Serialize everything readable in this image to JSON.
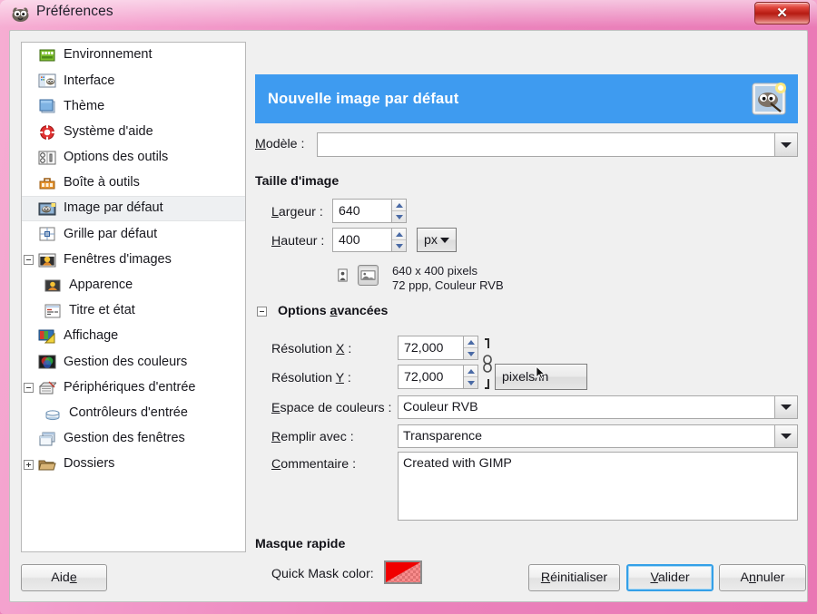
{
  "window": {
    "title": "Préférences",
    "title_icon": "gimp-wilber-icon",
    "close_label": "✕",
    "frame_color": "#ef8fc3"
  },
  "sidebar": {
    "items": [
      {
        "label": "Environnement",
        "icon": "environment-icon",
        "level": 0,
        "expander": "none",
        "selected": false
      },
      {
        "label": "Interface",
        "icon": "interface-icon",
        "level": 0,
        "expander": "none",
        "selected": false
      },
      {
        "label": "Thème",
        "icon": "theme-icon",
        "level": 0,
        "expander": "none",
        "selected": false
      },
      {
        "label": "Système d'aide",
        "icon": "help-system-icon",
        "level": 0,
        "expander": "none",
        "selected": false
      },
      {
        "label": "Options des outils",
        "icon": "tool-options-icon",
        "level": 0,
        "expander": "none",
        "selected": false
      },
      {
        "label": "Boîte à outils",
        "icon": "toolbox-icon",
        "level": 0,
        "expander": "none",
        "selected": false
      },
      {
        "label": "Image par défaut",
        "icon": "default-image-icon",
        "level": 0,
        "expander": "none",
        "selected": true
      },
      {
        "label": "Grille par défaut",
        "icon": "default-grid-icon",
        "level": 0,
        "expander": "none",
        "selected": false
      },
      {
        "label": "Fenêtres d'images",
        "icon": "image-windows-icon",
        "level": 0,
        "expander": "expanded",
        "selected": false
      },
      {
        "label": "Apparence",
        "icon": "appearance-icon",
        "level": 1,
        "expander": "none",
        "selected": false
      },
      {
        "label": "Titre et état",
        "icon": "title-and-status-icon",
        "level": 1,
        "expander": "none",
        "selected": false
      },
      {
        "label": "Affichage",
        "icon": "display-icon",
        "level": 0,
        "expander": "none",
        "selected": false
      },
      {
        "label": "Gestion des couleurs",
        "icon": "color-management-icon",
        "level": 0,
        "expander": "none",
        "selected": false
      },
      {
        "label": "Périphériques d'entrée",
        "icon": "input-devices-icon",
        "level": 0,
        "expander": "expanded",
        "selected": false
      },
      {
        "label": "Contrôleurs d'entrée",
        "icon": "input-controllers-icon",
        "level": 1,
        "expander": "none",
        "selected": false
      },
      {
        "label": "Gestion des fenêtres",
        "icon": "window-management-icon",
        "level": 0,
        "expander": "none",
        "selected": false
      },
      {
        "label": "Dossiers",
        "icon": "folders-icon",
        "level": 0,
        "expander": "collapsed",
        "selected": false
      }
    ]
  },
  "page": {
    "header_title": "Nouvelle image par défaut",
    "header_icon": "gimp-default-image-icon",
    "header_bg": "#3e9bf0",
    "template": {
      "label": "Modèle :",
      "value": "",
      "arrow_icon": "chevron-down-icon"
    },
    "image_size": {
      "section_title": "Taille d'image",
      "width_label": "Largeur :",
      "width_value": "640",
      "height_label": "Hauteur :",
      "height_value": "400",
      "unit_button": "px",
      "portrait_icon": "portrait-orientation-icon",
      "landscape_icon": "landscape-orientation-icon",
      "info_line1": "640 x 400 pixels",
      "info_line2": "72 ppp, Couleur RVB"
    },
    "advanced": {
      "section_title": "Options avancées",
      "expander": "expanded",
      "res_x_label": "Résolution X :",
      "res_x_value": "72,000",
      "res_y_label": "Résolution Y :",
      "res_y_value": "72,000",
      "chain_icon": "chain-link-icon",
      "res_unit_button": "pixels/in",
      "colorspace_label": "Espace de couleurs :",
      "colorspace_value": "Couleur RVB",
      "fill_label": "Remplir avec :",
      "fill_value": "Transparence",
      "comment_label": "Commentaire :",
      "comment_value": "Created with GIMP"
    },
    "quickmask": {
      "section_title": "Masque rapide",
      "color_label": "Quick Mask color:",
      "color_value": "#f00000",
      "swatch_icon": "color-swatch"
    }
  },
  "footer": {
    "help": "Aide",
    "reset": "Réinitialiser",
    "ok": "Valider",
    "cancel": "Annuler"
  },
  "cursor": {
    "icon": "mouse-pointer-icon"
  }
}
